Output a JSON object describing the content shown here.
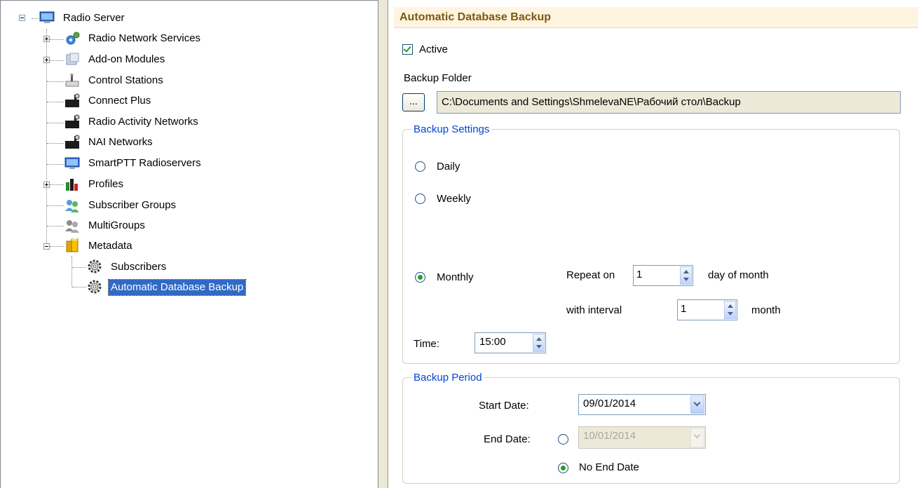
{
  "tree": {
    "root": "Radio Server",
    "items": [
      {
        "label": "Radio Network Services",
        "icon": "gear-network-icon"
      },
      {
        "label": "Add-on Modules",
        "icon": "modules-icon"
      },
      {
        "label": "Control Stations",
        "icon": "control-station-icon"
      },
      {
        "label": "Connect Plus",
        "icon": "radio-icon"
      },
      {
        "label": "Radio Activity Networks",
        "icon": "radio-icon"
      },
      {
        "label": "NAI Networks",
        "icon": "radio-icon"
      },
      {
        "label": "SmartPTT Radioservers",
        "icon": "computer-icon"
      },
      {
        "label": "Profiles",
        "icon": "profiles-icon"
      },
      {
        "label": "Subscriber Groups",
        "icon": "users-icon"
      },
      {
        "label": "MultiGroups",
        "icon": "users-gray-icon"
      },
      {
        "label": "Metadata",
        "icon": "database-icon"
      }
    ],
    "metadata_children": [
      {
        "label": "Subscribers",
        "icon": "gear-icon"
      },
      {
        "label": "Automatic Database Backup",
        "icon": "gear-icon"
      }
    ]
  },
  "panel": {
    "title": "Automatic Database Backup",
    "active_label": "Active",
    "active_checked": true,
    "backup_folder_label": "Backup Folder",
    "browse_label": "...",
    "backup_folder_path": "C:\\Documents and Settings\\ShmelevaNE\\Рабочий стол\\Backup"
  },
  "backup_settings": {
    "title": "Backup Settings",
    "daily_label": "Daily",
    "weekly_label": "Weekly",
    "monthly_label": "Monthly",
    "selected": "Monthly",
    "repeat_on_label": "Repeat on",
    "repeat_on_value": "1",
    "day_of_month_label": "day of month",
    "with_interval_label": "with interval",
    "interval_value": "1",
    "month_label": "month",
    "time_label": "Time:",
    "time_value": "15:00"
  },
  "backup_period": {
    "title": "Backup Period",
    "start_date_label": "Start Date:",
    "start_date_value": "09/01/2014",
    "end_date_label": "End Date:",
    "end_date_value": "10/01/2014",
    "no_end_date_label": "No End Date",
    "no_end_date_selected": true
  },
  "colors": {
    "header_bg": "#fff4e0",
    "header_text": "#7a5a12",
    "group_title": "#0046d5",
    "selection": "#316ac5",
    "radio_check": "#21a121"
  }
}
